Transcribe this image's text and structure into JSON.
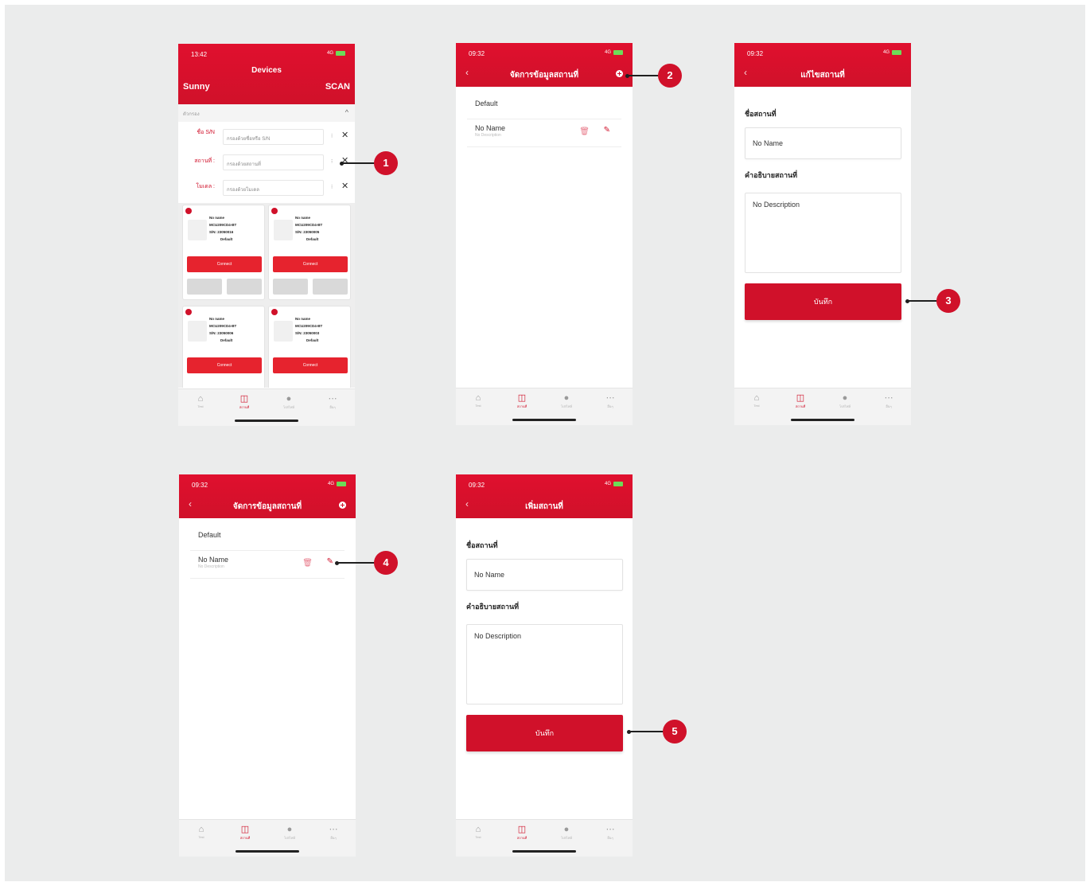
{
  "screen1": {
    "time": "13:42",
    "title": "Devices",
    "name": "Sunny",
    "scan": "SCAN",
    "filter_label": "ตัวกรอง",
    "filters": [
      {
        "label": "ชื่อ S/N",
        "placeholder": "กรองด้วยชื่อหรือ S/N"
      },
      {
        "label": "สถานที่ :",
        "placeholder": "กรองด้วยสถานที่"
      },
      {
        "label": "โมเดล :",
        "placeholder": "กรองด้วยโมเดล"
      }
    ],
    "cards": [
      {
        "name": "No name",
        "model": "MCU209CD4-BT",
        "sn": "S/N: 23050016",
        "location": "Default",
        "button": "Connect"
      },
      {
        "name": "No name",
        "model": "MCU209CD4-BT",
        "sn": "S/N: 23050005",
        "location": "Default",
        "button": "Connect"
      },
      {
        "name": "No name",
        "model": "MCU209CD4-BT",
        "sn": "S/N: 23050006",
        "location": "Default",
        "button": "Connect"
      },
      {
        "name": "No name",
        "model": "MCU209CD4-BT",
        "sn": "S/N: 23050003",
        "location": "Default",
        "button": "Connect"
      }
    ]
  },
  "status_time": "09:32",
  "status_net": "4G",
  "manage_title": "จัดการข้อมูลสถานที่",
  "edit_title": "แก้ไขสถานที่",
  "add_title": "เพิ่มสถานที่",
  "default_label": "Default",
  "item_name": "No Name",
  "item_desc": "No Description",
  "field_name_label": "ชื่อสถานที่",
  "field_desc_label": "คำอธิบายสถานที่",
  "save_label": "บันทึก",
  "tabs": [
    "Test",
    "สถานที่",
    "โปรไฟล์",
    "อื่นๆ"
  ],
  "callouts": [
    "1",
    "2",
    "3",
    "4",
    "5"
  ],
  "colors": {
    "brand": "#d0112a",
    "background": "#ebecec"
  }
}
